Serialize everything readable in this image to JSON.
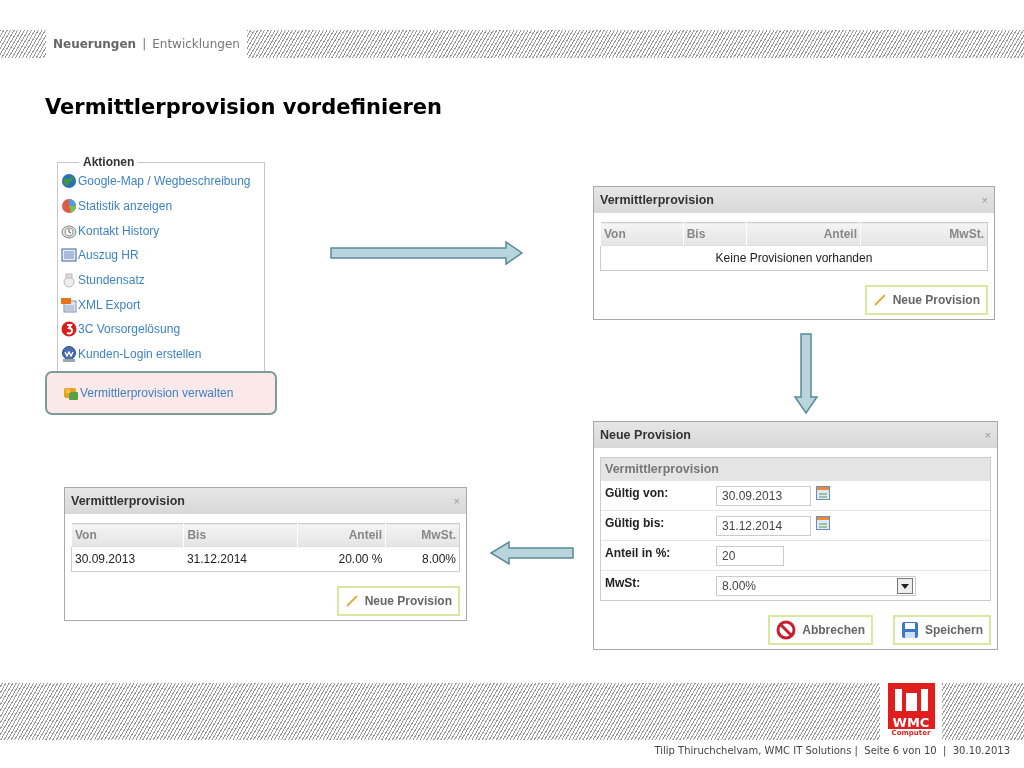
{
  "header": {
    "section": "Neuerungen",
    "separator": "|",
    "subsection": "Entwicklungen"
  },
  "title": "Vermittlerprovision vordefinieren",
  "actions": {
    "legend": "Aktionen",
    "items": [
      {
        "label": "Google-Map / Wegbeschreibung",
        "selected": false
      },
      {
        "label": "Statistik anzeigen",
        "selected": false
      },
      {
        "label": "Kontakt History",
        "selected": false
      },
      {
        "label": "Auszug HR",
        "selected": false
      },
      {
        "label": "Stundensatz",
        "selected": false
      },
      {
        "label": "XML Export",
        "selected": false
      },
      {
        "label": "3C Vorsorgelösung",
        "selected": false
      },
      {
        "label": "Kunden-Login erstellen",
        "selected": false
      },
      {
        "label": "Vermittlerprovision verwalten",
        "selected": true
      }
    ]
  },
  "dialogs": [
    {
      "kind": "table",
      "title": "Vermittlerprovision",
      "close": "×",
      "columns": [
        "Von",
        "Bis",
        "Anteil",
        "MwSt."
      ],
      "empty_text": "Keine Provisionen vorhanden",
      "buttons": [
        {
          "kind": "new",
          "label": "Neue Provision"
        }
      ]
    },
    {
      "kind": "form",
      "title": "Neue Provision",
      "close": "×",
      "section": "Vermittlerprovision",
      "fields": [
        {
          "kind": "date",
          "label": "Gültig von:",
          "value": "30.09.2013"
        },
        {
          "kind": "date",
          "label": "Gültig bis:",
          "value": "31.12.2014"
        },
        {
          "kind": "text",
          "label": "Anteil in %:",
          "value": "20"
        },
        {
          "kind": "select",
          "label": "MwSt:",
          "value": "8.00%"
        }
      ],
      "buttons": [
        {
          "kind": "cancel",
          "label": "Abbrechen"
        },
        {
          "kind": "save",
          "label": "Speichern"
        }
      ]
    },
    {
      "kind": "table",
      "title": "Vermittlerprovision",
      "close": "×",
      "columns": [
        "Von",
        "Bis",
        "Anteil",
        "MwSt."
      ],
      "rows": [
        [
          "30.09.2013",
          "31.12.2014",
          "20.00 %",
          "8.00%"
        ]
      ],
      "buttons": [
        {
          "kind": "new",
          "label": "Neue Provision"
        }
      ]
    }
  ],
  "footer": {
    "logo": {
      "name": "WMC",
      "tagline": "Computer"
    },
    "text": "Tilip Thiruchchelvam, WMC IT Solutions |  Seite 6 von 10  |  30.10.2013"
  }
}
